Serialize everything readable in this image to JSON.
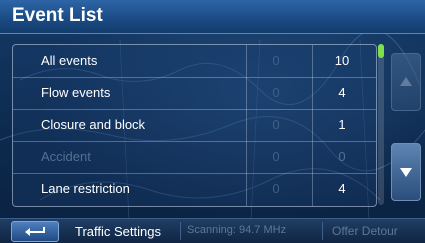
{
  "title": "Event List",
  "events": [
    {
      "name": "All events",
      "col1": "0",
      "col2": "10",
      "enabled": true
    },
    {
      "name": "Flow events",
      "col1": "0",
      "col2": "4",
      "enabled": true
    },
    {
      "name": "Closure and block",
      "col1": "0",
      "col2": "1",
      "enabled": true
    },
    {
      "name": "Accident",
      "col1": "0",
      "col2": "0",
      "enabled": false
    },
    {
      "name": "Lane restriction",
      "col1": "0",
      "col2": "4",
      "enabled": true
    }
  ],
  "bottom": {
    "settings_label": "Traffic Settings",
    "scanning_label": "Scanning:",
    "frequency": "94.7 MHz",
    "detour_label": "Offer Detour"
  },
  "icons": {
    "back": "back-arrow-icon",
    "up": "arrow-up-icon",
    "down": "arrow-down-icon"
  },
  "colors": {
    "accent": "#7ee04a",
    "title_bar": "#2e65a6"
  }
}
